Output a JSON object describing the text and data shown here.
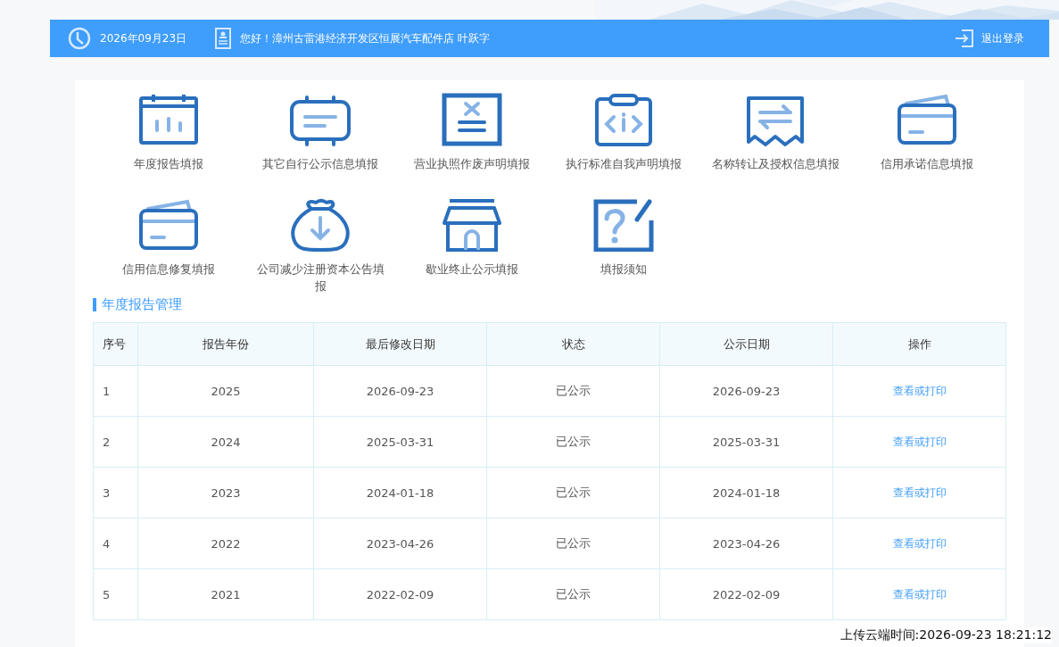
{
  "header": {
    "date": "2026年09月23日",
    "greeting": "您好！漳州古雷港经济开发区恒展汽车配件店 叶跃字",
    "logout": "退出登录"
  },
  "shortcuts": [
    {
      "label": "年度报告填报"
    },
    {
      "label": "其它自行公示信息填报"
    },
    {
      "label": "营业执照作废声明填报"
    },
    {
      "label": "执行标准自我声明填报"
    },
    {
      "label": "名称转让及授权信息填报"
    },
    {
      "label": "信用承诺信息填报"
    },
    {
      "label": "信用信息修复填报"
    },
    {
      "label": "公司减少注册资本公告填报"
    },
    {
      "label": "歇业终止公示填报"
    },
    {
      "label": "填报须知"
    }
  ],
  "section_title": "年度报告管理",
  "table": {
    "columns": [
      "序号",
      "报告年份",
      "最后修改日期",
      "状态",
      "公示日期",
      "操作"
    ],
    "rows": [
      [
        "1",
        "2025",
        "2026-09-23",
        "已公示",
        "2026-09-23",
        "查看或打印"
      ],
      [
        "2",
        "2024",
        "2025-03-31",
        "已公示",
        "2025-03-31",
        "查看或打印"
      ],
      [
        "3",
        "2023",
        "2024-01-18",
        "已公示",
        "2024-01-18",
        "查看或打印"
      ],
      [
        "4",
        "2022",
        "2023-04-26",
        "已公示",
        "2023-04-26",
        "查看或打印"
      ],
      [
        "5",
        "2021",
        "2022-02-09",
        "已公示",
        "2022-02-09",
        "查看或打印"
      ]
    ]
  },
  "upload_time": "上传云端时间:2026-09-23 18:21:12"
}
